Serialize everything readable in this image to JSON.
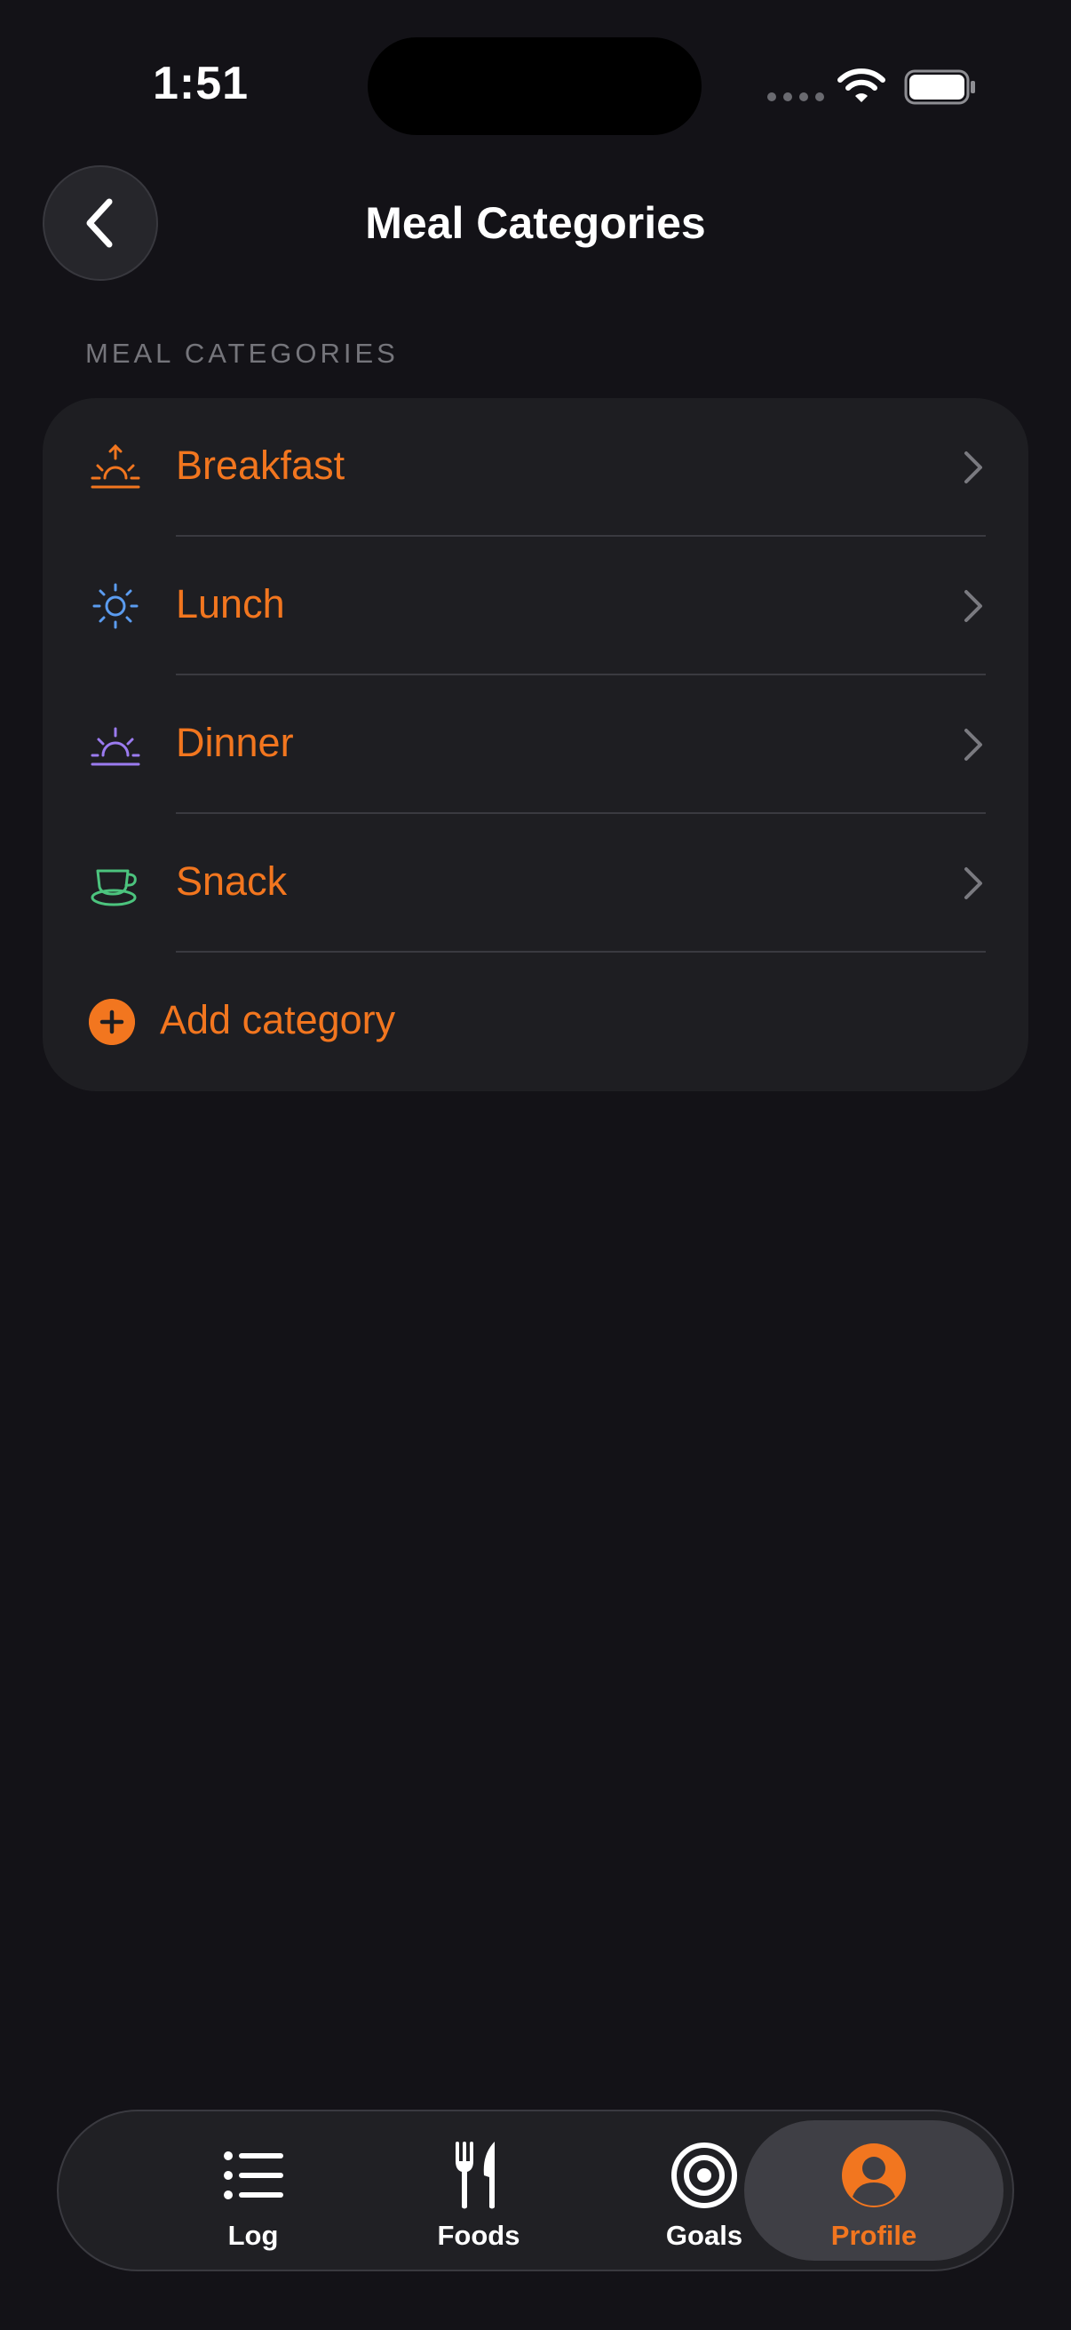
{
  "status_bar": {
    "time": "1:51"
  },
  "header": {
    "back_icon": "chevron-left-icon",
    "title": "Meal Categories"
  },
  "section": {
    "header": "MEAL CATEGORIES",
    "items": [
      {
        "label": "Breakfast",
        "icon": "sunrise-icon",
        "icon_color": "#f2761f"
      },
      {
        "label": "Lunch",
        "icon": "sun-icon",
        "icon_color": "#5b9cf0"
      },
      {
        "label": "Dinner",
        "icon": "sunset-icon",
        "icon_color": "#9b7bf0"
      },
      {
        "label": "Snack",
        "icon": "cup-icon",
        "icon_color": "#4cc47e"
      }
    ],
    "add_label": "Add category"
  },
  "tab_bar": {
    "tabs": [
      {
        "label": "Log",
        "icon": "list-icon",
        "active": false
      },
      {
        "label": "Foods",
        "icon": "fork-knife-icon",
        "active": false
      },
      {
        "label": "Goals",
        "icon": "target-icon",
        "active": false
      },
      {
        "label": "Profile",
        "icon": "person-circle-icon",
        "active": true
      }
    ]
  },
  "colors": {
    "accent": "#f2761f",
    "background": "#131217",
    "card": "#1e1e22"
  }
}
